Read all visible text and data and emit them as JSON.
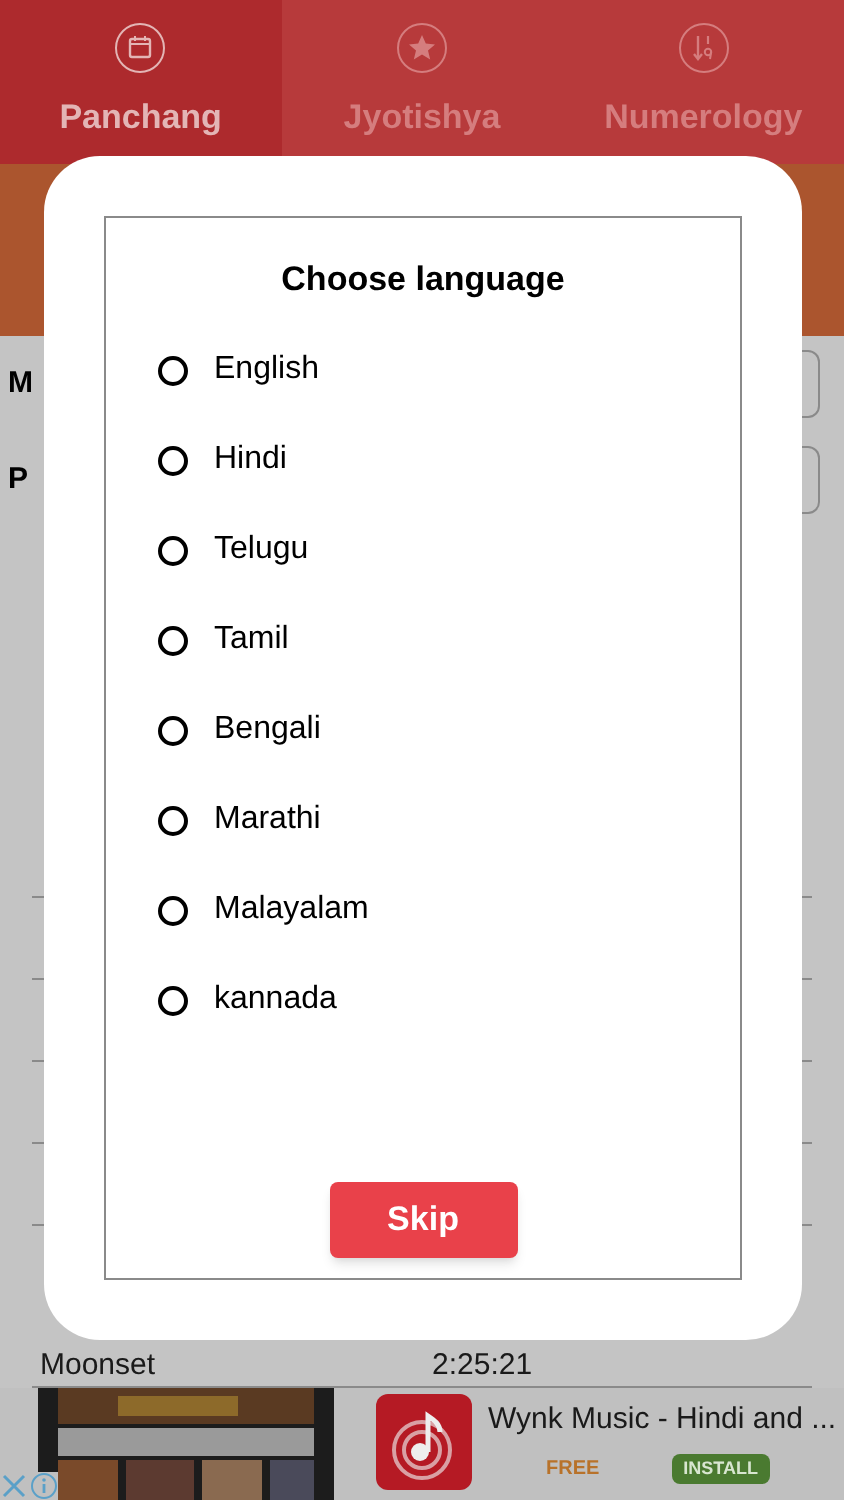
{
  "tabs": [
    {
      "label": "Panchang",
      "selected": true
    },
    {
      "label": "Jyotishya",
      "selected": false
    },
    {
      "label": "Numerology",
      "selected": false
    }
  ],
  "background_rows": [
    {
      "label": "M"
    },
    {
      "label": "P"
    }
  ],
  "moonset": {
    "label": "Moonset",
    "value": "2:25:21"
  },
  "dialog": {
    "title": "Choose language",
    "options": [
      {
        "label": "English",
        "selected": false
      },
      {
        "label": "Hindi",
        "selected": false
      },
      {
        "label": "Telugu",
        "selected": false
      },
      {
        "label": "Tamil",
        "selected": false
      },
      {
        "label": "Bengali",
        "selected": false
      },
      {
        "label": "Marathi",
        "selected": false
      },
      {
        "label": "Malayalam",
        "selected": false
      },
      {
        "label": "kannada",
        "selected": false
      }
    ],
    "skip_button": "Skip"
  },
  "ad": {
    "title": "Wynk Music - Hindi and ...",
    "price": "FREE",
    "install_button": "INSTALL"
  }
}
